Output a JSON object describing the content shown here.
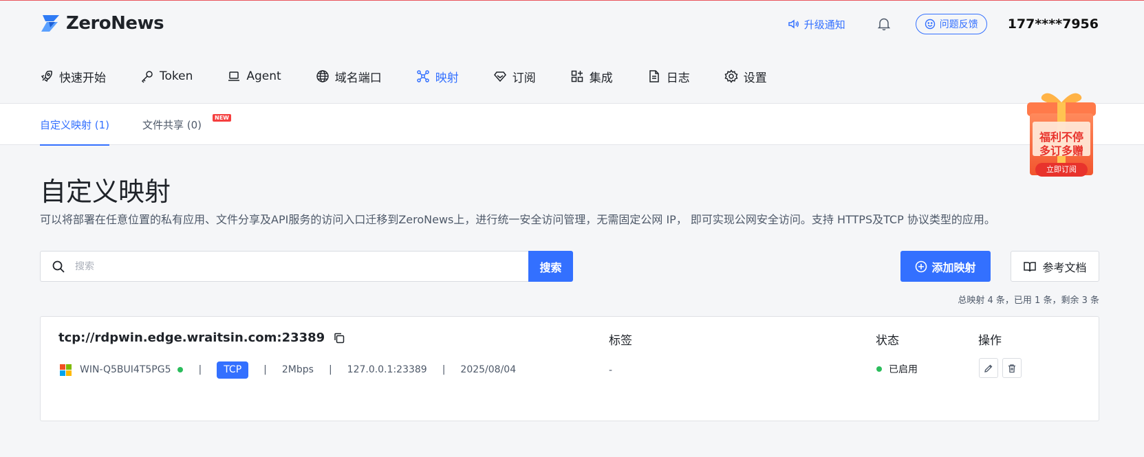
{
  "app": {
    "logo_text": "ZeroNews"
  },
  "header": {
    "notify_label": "升级通知",
    "feedback_label": "问题反馈",
    "user": "177****7956"
  },
  "nav": [
    {
      "label": "快速开始",
      "icon": "rocket-icon"
    },
    {
      "label": "Token",
      "icon": "key-icon"
    },
    {
      "label": "Agent",
      "icon": "laptop-icon"
    },
    {
      "label": "域名端口",
      "icon": "globe-icon"
    },
    {
      "label": "映射",
      "icon": "network-icon",
      "active": true
    },
    {
      "label": "订阅",
      "icon": "diamond-icon"
    },
    {
      "label": "集成",
      "icon": "apps-icon"
    },
    {
      "label": "日志",
      "icon": "document-icon"
    },
    {
      "label": "设置",
      "icon": "gear-icon"
    }
  ],
  "subtabs": [
    {
      "label": "自定义映射 (1)",
      "active": true
    },
    {
      "label": "文件共享 (0)",
      "badge": "NEW"
    }
  ],
  "promo": {
    "line1": "福利不停",
    "line2": "多订多赠",
    "cta": "立即订阅"
  },
  "page": {
    "title": "自定义映射",
    "description": "可以将部署在任意位置的私有应用、文件分享及API服务的访问入口迁移到ZeroNews上，进行统一安全访问管理，无需固定公网 IP， 即可实现公网安全访问。支持 HTTPS及TCP 协议类型的应用。"
  },
  "search": {
    "placeholder": "搜索",
    "button": "搜索"
  },
  "actions": {
    "add": "添加映射",
    "docs": "参考文档"
  },
  "stats": "总映射 4 条，已用 1 条，剩余 3 条",
  "columns": {
    "tags": "标签",
    "status": "状态",
    "ops": "操作"
  },
  "mapping": {
    "address": "tcp://rdpwin.edge.wraitsin.com:23389",
    "agent": "WIN-Q5BUI4T5PG5",
    "protocol": "TCP",
    "bandwidth": "2Mbps",
    "local": "127.0.0.1:23389",
    "date": "2025/08/04",
    "tags": "-",
    "status": "已启用",
    "status_color": "#2bbd5c"
  },
  "colors": {
    "accent": "#3370ff",
    "danger": "#f53f3f",
    "success": "#2bbd5c"
  }
}
